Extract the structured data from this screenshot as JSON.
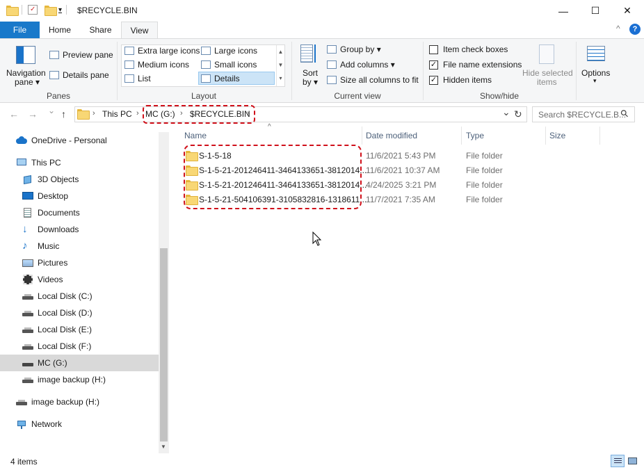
{
  "window": {
    "title": "$RECYCLE.BIN",
    "minimize_glyph": "—",
    "maximize_glyph": "☐",
    "close_glyph": "✕",
    "qa_dropdown": "▾"
  },
  "tabs": [
    {
      "label": "File"
    },
    {
      "label": "Home"
    },
    {
      "label": "Share"
    },
    {
      "label": "View"
    }
  ],
  "ribbon_controls": {
    "minimize": "^",
    "help": "?"
  },
  "ribbon": {
    "panes": {
      "navigation_pane": "Navigation",
      "navigation_pane_2": "pane ▾",
      "preview_pane": "Preview pane",
      "details_pane": "Details pane",
      "label": "Panes"
    },
    "layout": {
      "extra_large": "Extra large icons",
      "large": "Large icons",
      "medium": "Medium icons",
      "small": "Small icons",
      "list": "List",
      "details": "Details",
      "label": "Layout"
    },
    "current_view": {
      "sort_by": "Sort",
      "sort_by_2": "by ▾",
      "group_by": "Group by ▾",
      "add_columns": "Add columns ▾",
      "size_all": "Size all columns to fit",
      "label": "Current view"
    },
    "show_hide": {
      "item_check_boxes": "Item check boxes",
      "file_name_extensions": "File name extensions",
      "hidden_items": "Hidden items",
      "hide_selected": "Hide selected",
      "hide_selected_2": "items",
      "options": "Options",
      "label": "Show/hide",
      "item_check_boxes_checked": false,
      "file_name_extensions_checked": true,
      "hidden_items_checked": true
    }
  },
  "address": {
    "crumbs": [
      "This PC",
      "MC (G:)",
      "$RECYCLE.BIN"
    ],
    "sep": "›",
    "search_placeholder": "Search $RECYCLE.B..."
  },
  "nav_glyphs": {
    "back": "←",
    "forward": "→",
    "recent": "⌄",
    "up": "↑",
    "dropdown": "⌄",
    "refresh": "↻",
    "search": "⚲"
  },
  "navpane": {
    "items": [
      {
        "label": "OneDrive - Personal"
      },
      {
        "label": "This PC"
      },
      {
        "label": "3D Objects"
      },
      {
        "label": "Desktop"
      },
      {
        "label": "Documents"
      },
      {
        "label": "Downloads"
      },
      {
        "label": "Music"
      },
      {
        "label": "Pictures"
      },
      {
        "label": "Videos"
      },
      {
        "label": "Local Disk (C:)"
      },
      {
        "label": "Local Disk (D:)"
      },
      {
        "label": "Local Disk (E:)"
      },
      {
        "label": "Local Disk (F:)"
      },
      {
        "label": "MC (G:)"
      },
      {
        "label": "image backup (H:)"
      },
      {
        "label": "image backup (H:)"
      },
      {
        "label": "Network"
      }
    ]
  },
  "columns": {
    "name": "Name",
    "date": "Date modified",
    "type": "Type",
    "size": "Size",
    "sort_glyph": "^"
  },
  "files": [
    {
      "name": "S-1-5-18",
      "date": "11/6/2021 5:43 PM",
      "type": "File folder"
    },
    {
      "name": "S-1-5-21-201246411-3464133651-3812014...",
      "date": "11/6/2021 10:37 AM",
      "type": "File folder"
    },
    {
      "name": "S-1-5-21-201246411-3464133651-3812014...",
      "date": "4/24/2025 3:21 PM",
      "type": "File folder"
    },
    {
      "name": "S-1-5-21-504106391-3105832816-1318611...",
      "date": "11/7/2021 7:35 AM",
      "type": "File folder"
    }
  ],
  "status": {
    "count": "4 items"
  },
  "colors": {
    "accent": "#1979ca",
    "highlight": "#d0101a",
    "selection": "#cce4f7"
  }
}
